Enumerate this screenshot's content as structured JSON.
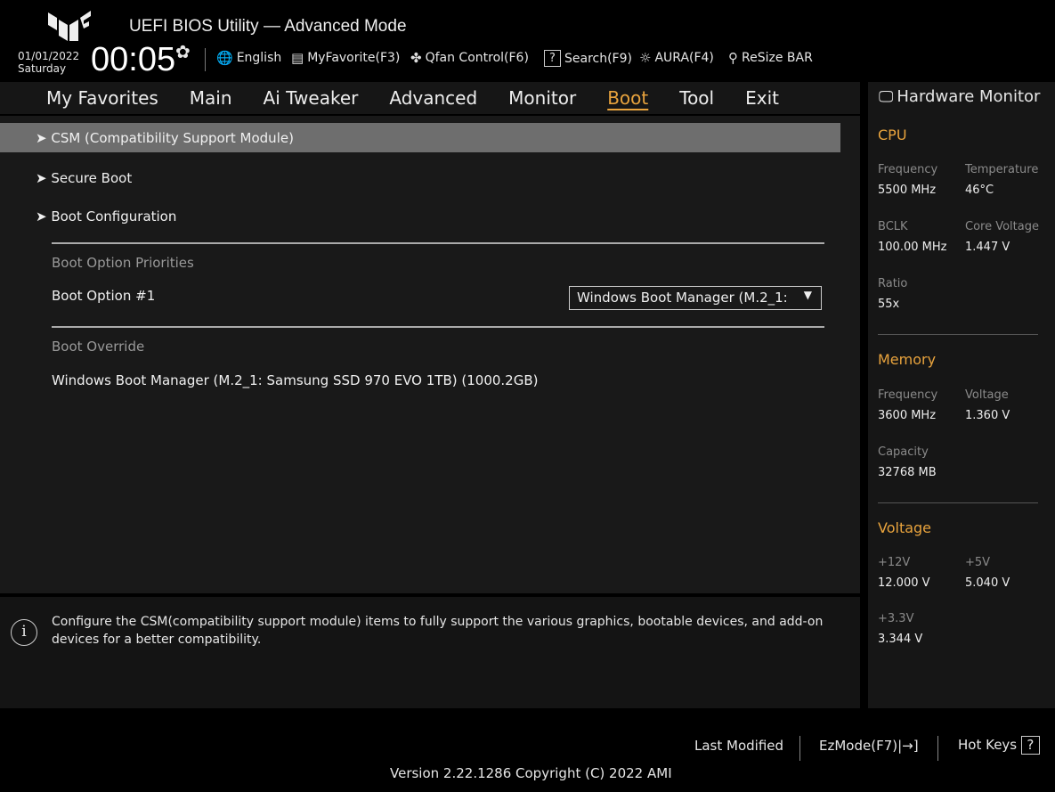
{
  "header": {
    "title": "UEFI BIOS Utility — Advanced Mode",
    "date": "01/01/2022",
    "day": "Saturday",
    "time": "00:05",
    "toolbar": [
      {
        "icon": "globe-icon",
        "glyph": "🌐",
        "label": "English"
      },
      {
        "icon": "favorite-icon",
        "glyph": "▤",
        "label": "MyFavorite(F3)"
      },
      {
        "icon": "fan-icon",
        "glyph": "✤",
        "label": "Qfan Control(F6)"
      },
      {
        "icon": "search-icon",
        "glyph": "?",
        "label": "Search(F9)"
      },
      {
        "icon": "aura-icon",
        "glyph": "☼",
        "label": "AURA(F4)"
      },
      {
        "icon": "resize-bar-icon",
        "glyph": "⚲",
        "label": "ReSize BAR"
      }
    ]
  },
  "nav": {
    "tabs": [
      "My Favorites",
      "Main",
      "Ai Tweaker",
      "Advanced",
      "Monitor",
      "Boot",
      "Tool",
      "Exit"
    ],
    "active": "Boot"
  },
  "main": {
    "items": [
      "CSM (Compatibility Support Module)",
      "Secure Boot",
      "Boot Configuration"
    ],
    "priorities_label": "Boot Option Priorities",
    "boot_option_label": "Boot Option #1",
    "boot_option_value": "Windows Boot Manager (M.2_1:",
    "override_label": "Boot Override",
    "override_item": "Windows Boot Manager (M.2_1: Samsung SSD 970 EVO 1TB) (1000.2GB)"
  },
  "help": {
    "text": "Configure the CSM(compatibility support module) items to fully support the various graphics, bootable devices, and add-on devices for a better compatibility."
  },
  "hw": {
    "title": "Hardware Monitor",
    "cpu": {
      "title": "CPU",
      "freq_k": "Frequency",
      "freq_v": "5500 MHz",
      "temp_k": "Temperature",
      "temp_v": "46°C",
      "bclk_k": "BCLK",
      "bclk_v": "100.00 MHz",
      "cv_k": "Core Voltage",
      "cv_v": "1.447 V",
      "ratio_k": "Ratio",
      "ratio_v": "55x"
    },
    "memory": {
      "title": "Memory",
      "freq_k": "Frequency",
      "freq_v": "3600 MHz",
      "volt_k": "Voltage",
      "volt_v": "1.360 V",
      "cap_k": "Capacity",
      "cap_v": "32768 MB"
    },
    "voltage": {
      "title": "Voltage",
      "v12_k": "+12V",
      "v12_v": "12.000 V",
      "v5_k": "+5V",
      "v5_v": "5.040 V",
      "v33_k": "+3.3V",
      "v33_v": "3.344 V"
    }
  },
  "footer": {
    "last_modified": "Last Modified",
    "ezmode": "EzMode(F7)|→]",
    "hotkeys": "Hot Keys",
    "hotkeys_glyph": "?",
    "version": "Version 2.22.1286 Copyright (C) 2022 AMI"
  },
  "colors": {
    "accent": "#e8a33d",
    "highlight": "#6e6e6e"
  }
}
